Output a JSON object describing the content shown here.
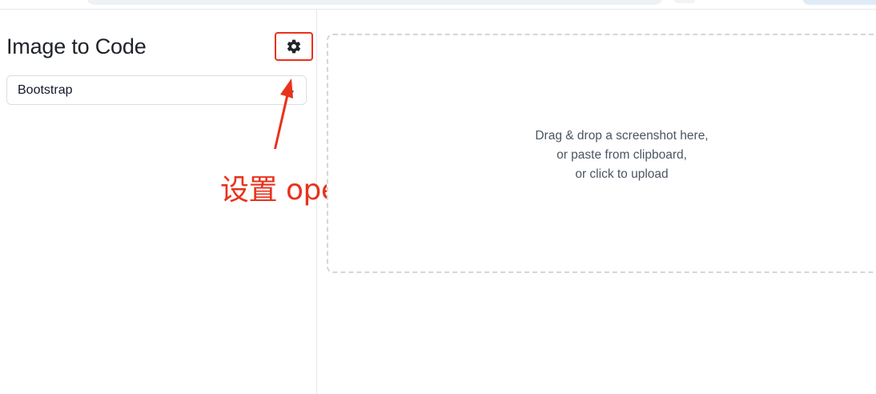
{
  "sidebar": {
    "title": "Image to Code",
    "settings_icon": "gear-icon",
    "framework_select": {
      "selected": "Bootstrap"
    }
  },
  "annotation": {
    "text": "设置 openai api key",
    "color": "#e9321c"
  },
  "dropzone": {
    "lines": [
      "Drag & drop a screenshot here,",
      "or paste from clipboard,",
      "or click to upload"
    ]
  }
}
